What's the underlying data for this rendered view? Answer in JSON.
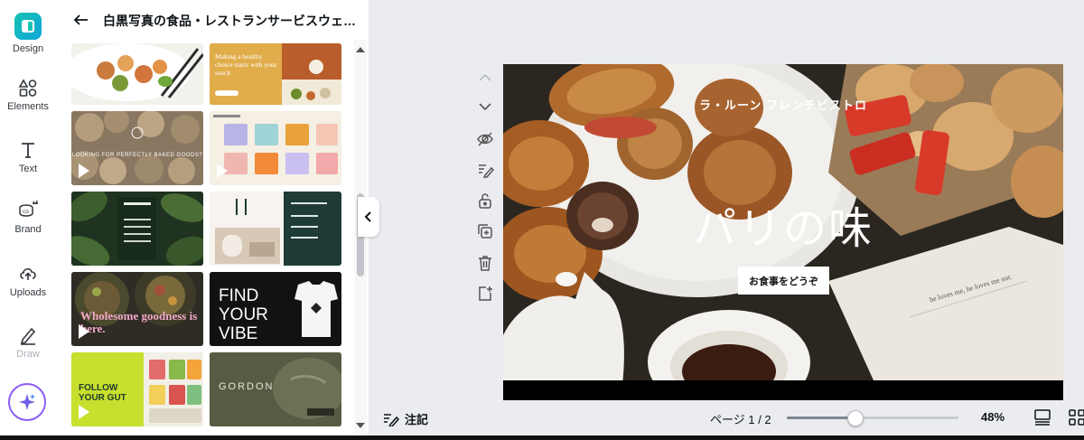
{
  "rail": {
    "items": [
      {
        "label": "Design",
        "icon": "design-logo-icon"
      },
      {
        "label": "Elements",
        "icon": "shapes-icon"
      },
      {
        "label": "Text",
        "icon": "text-icon"
      },
      {
        "label": "Brand",
        "icon": "brand-crown-icon"
      },
      {
        "label": "Uploads",
        "icon": "upload-cloud-icon"
      },
      {
        "label": "Draw",
        "icon": "pen-icon"
      }
    ],
    "magic_icon": "sparkle-icon"
  },
  "panel": {
    "title": "白黒写真の食品・レストランサービスウェ…",
    "templates": [
      {
        "text": ""
      },
      {
        "text": "Making a healthy choice starts with your snack"
      },
      {
        "text": "LOOKING FOR PERFECTLY BAKED GOODS?"
      },
      {
        "text": ""
      },
      {
        "text": ""
      },
      {
        "text": ""
      },
      {
        "text": "Wholesome goodness is here."
      },
      {
        "text": "FIND YOUR VIBE"
      },
      {
        "text": "FOLLOW YOUR GUT"
      },
      {
        "text": "GORDON"
      }
    ]
  },
  "canvas": {
    "subtitle": "ラ・ルーン フレンチビストロ",
    "title": "パリの味",
    "cta": "お食事をどうぞ",
    "book_text": "he loves me, he loves me not."
  },
  "bottombar": {
    "notes_label": "注記",
    "page_indicator": "ページ 1 / 2",
    "zoom_percent": 48,
    "zoom_label": "48%"
  },
  "colors": {
    "accent": "#8b5cf6",
    "design_teal": "#17c3b2"
  }
}
